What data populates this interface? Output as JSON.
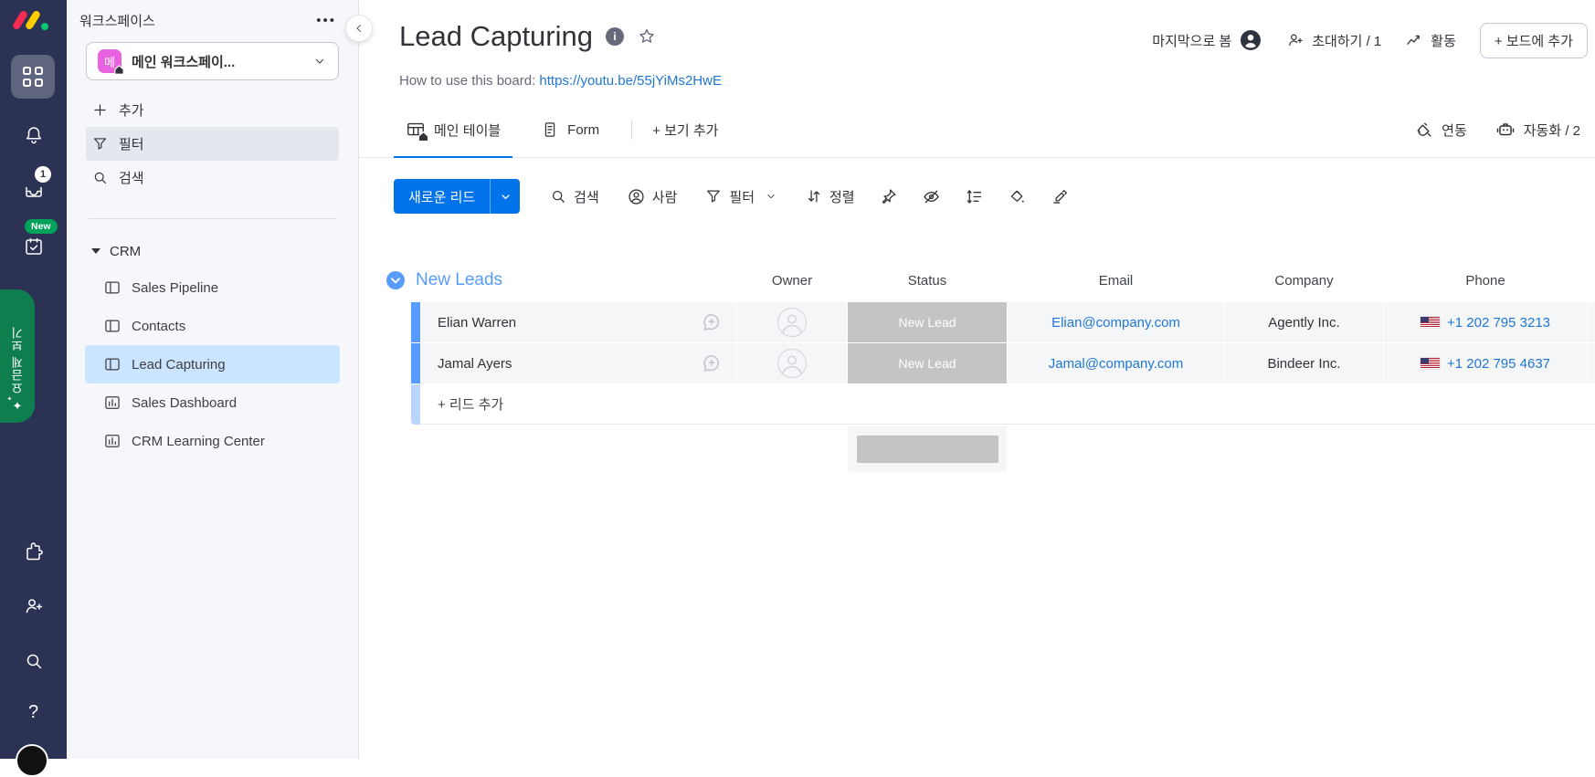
{
  "colors": {
    "accent_blue": "#0073ea",
    "link_blue": "#1f76d3",
    "group_blue": "#579bfc",
    "status_gray": "#c4c4c4",
    "rail_navy": "#2b3254",
    "promo_green": "#0f7e4f",
    "new_badge_green": "#00a25b",
    "selected_item_blue": "#cce5ff",
    "workspace_pink": "#e862df",
    "logo_red": "#f62b54",
    "logo_yellow": "#ffcc00",
    "logo_green": "#00ca72"
  },
  "rail": {
    "inbox_badge": "1",
    "work_badge": "New",
    "promo_label": "요금제 보기",
    "help_label": "?"
  },
  "sidebar": {
    "title": "워크스페이스",
    "menu_dots": "•••",
    "workspace": {
      "avatar_initial": "메",
      "name": "메인 워크스페이..."
    },
    "menu": {
      "add": "추가",
      "filter": "필터",
      "search": "검색"
    },
    "folder": {
      "label": "CRM",
      "items": [
        {
          "label": "Sales Pipeline"
        },
        {
          "label": "Contacts"
        },
        {
          "label": "Lead Capturing"
        },
        {
          "label": "Sales Dashboard"
        },
        {
          "label": "CRM Learning Center"
        }
      ]
    }
  },
  "header": {
    "title": "Lead Capturing",
    "how_to": "How to use this board:",
    "link": "https://youtu.be/55jYiMs2HwE",
    "last_seen": "마지막으로 봄",
    "invite": "초대하기 / 1",
    "activity": "활동",
    "add_to_board": "+ 보드에 추가"
  },
  "tabs": {
    "main_table": "메인 테이블",
    "form": "Form",
    "add_view": "+ 보기 추가",
    "integrate": "연동",
    "automate": "자동화 / 2"
  },
  "toolbar": {
    "new_item": "새로운 리드",
    "search": "검색",
    "person": "사람",
    "filter": "필터",
    "sort": "정렬"
  },
  "table": {
    "group_title": "New Leads",
    "columns": [
      "Owner",
      "Status",
      "Email",
      "Company",
      "Phone"
    ],
    "rows": [
      {
        "name": "Elian Warren",
        "status": "New Lead",
        "email": "Elian@company.com",
        "company": "Agently Inc.",
        "phone": "+1 202 795 3213"
      },
      {
        "name": "Jamal Ayers",
        "status": "New Lead",
        "email": "Jamal@company.com",
        "company": "Bindeer Inc.",
        "phone": "+1 202 795 4637"
      }
    ],
    "add_item": "+ 리드 추가"
  }
}
